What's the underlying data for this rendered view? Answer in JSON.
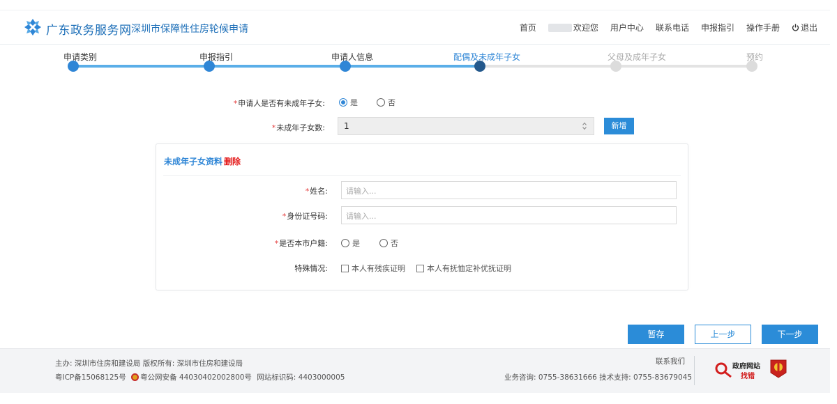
{
  "header": {
    "brand": "广东政务服务网",
    "subtitle": "深圳市保障性住房轮候申请",
    "nav": {
      "home": "首页",
      "welcome": "欢迎您",
      "user_center": "用户中心",
      "contact": "联系电话",
      "guide": "申报指引",
      "manual": "操作手册",
      "logout": "退出"
    }
  },
  "steps": [
    {
      "label": "申请类别",
      "state": "done"
    },
    {
      "label": "申报指引",
      "state": "done"
    },
    {
      "label": "申请人信息",
      "state": "done"
    },
    {
      "label": "配偶及未成年子女",
      "state": "current"
    },
    {
      "label": "父母及成年子女",
      "state": "todo"
    },
    {
      "label": "预约",
      "state": "todo"
    }
  ],
  "form": {
    "has_minor_label": "申请人是否有未成年子女:",
    "has_minor_options": [
      "是",
      "否"
    ],
    "has_minor_selected": "是",
    "minor_count_label": "未成年子女数:",
    "minor_count_value": "1",
    "add_button": "新增"
  },
  "child_card": {
    "title": "未成年子女资料",
    "delete": "删除",
    "name_label": "姓名:",
    "name_placeholder": "请输入...",
    "id_label": "身份证号码:",
    "id_placeholder": "请输入...",
    "hukou_label": "是否本市户籍:",
    "hukou_options": [
      "是",
      "否"
    ],
    "special_label": "特殊情况:",
    "special_options": [
      "本人有残疾证明",
      "本人有抚恤定补优抚证明"
    ]
  },
  "actions": {
    "save": "暂存",
    "prev": "上一步",
    "next": "下一步"
  },
  "footer": {
    "sponsor": "主办: 深圳市住房和建设局 版权所有: 深圳市住房和建设局",
    "icp": "粤ICP备15068125号",
    "police": "粤公网安备 44030402002800号",
    "site_code": "网站标识码: 4403000005",
    "contact_us": "联系我们",
    "hotline": "业务咨询: 0755-38631666 技术支持: 0755-83679045",
    "badge_line1": "政府网站",
    "badge_line2": "找错"
  },
  "colors": {
    "primary": "#2b8cd8",
    "step_active": "#23588c",
    "required": "#e43d3d",
    "delete": "#e41b1b"
  }
}
